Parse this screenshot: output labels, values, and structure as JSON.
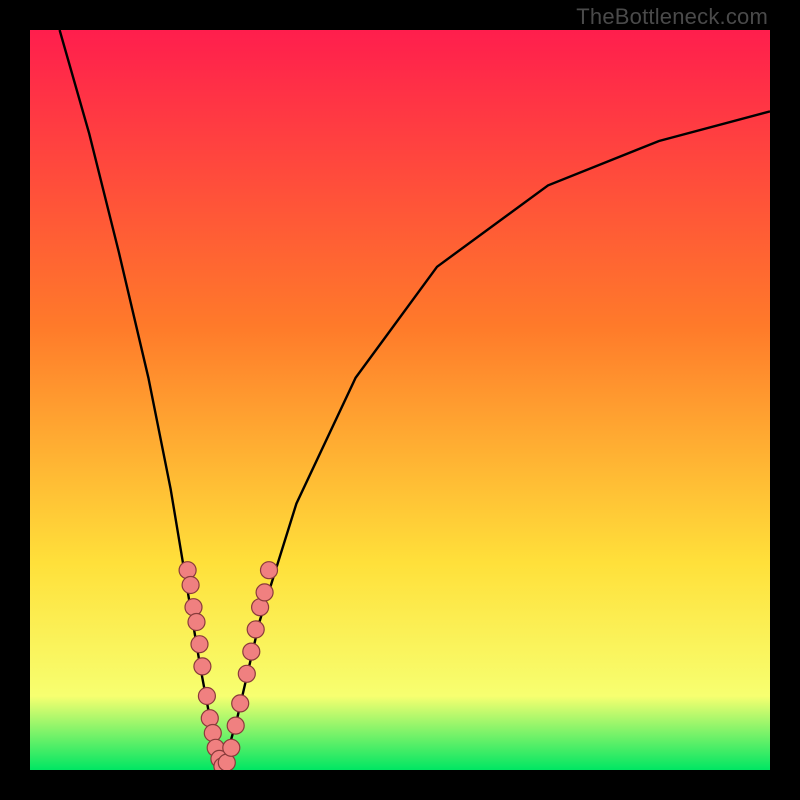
{
  "watermark": "TheBottleneck.com",
  "colors": {
    "bg": "#000000",
    "gradient_top": "#ff1e4d",
    "gradient_mid1": "#ff7a2a",
    "gradient_mid2": "#ffe03a",
    "gradient_mid3": "#f7ff70",
    "gradient_bottom": "#00e663",
    "curve": "#000000",
    "dot_fill": "#f08080",
    "dot_stroke": "#8a3b3b"
  },
  "chart_data": {
    "type": "line",
    "title": "",
    "xlabel": "",
    "ylabel": "",
    "xlim": [
      0,
      100
    ],
    "ylim": [
      0,
      100
    ],
    "curve": {
      "left_branch": [
        {
          "x": 4,
          "y": 100
        },
        {
          "x": 8,
          "y": 86
        },
        {
          "x": 12,
          "y": 70
        },
        {
          "x": 16,
          "y": 53
        },
        {
          "x": 19,
          "y": 38
        },
        {
          "x": 21,
          "y": 26
        },
        {
          "x": 23,
          "y": 14
        },
        {
          "x": 24.5,
          "y": 6
        },
        {
          "x": 26,
          "y": 0
        }
      ],
      "right_branch": [
        {
          "x": 26,
          "y": 0
        },
        {
          "x": 28,
          "y": 7
        },
        {
          "x": 31,
          "y": 20
        },
        {
          "x": 36,
          "y": 36
        },
        {
          "x": 44,
          "y": 53
        },
        {
          "x": 55,
          "y": 68
        },
        {
          "x": 70,
          "y": 79
        },
        {
          "x": 85,
          "y": 85
        },
        {
          "x": 100,
          "y": 89
        }
      ]
    },
    "highlight_points": [
      {
        "x": 21.3,
        "y": 27
      },
      {
        "x": 21.7,
        "y": 25
      },
      {
        "x": 22.1,
        "y": 22
      },
      {
        "x": 22.5,
        "y": 20
      },
      {
        "x": 22.9,
        "y": 17
      },
      {
        "x": 23.3,
        "y": 14
      },
      {
        "x": 23.9,
        "y": 10
      },
      {
        "x": 24.3,
        "y": 7
      },
      {
        "x": 24.7,
        "y": 5
      },
      {
        "x": 25.1,
        "y": 3
      },
      {
        "x": 25.6,
        "y": 1.5
      },
      {
        "x": 26.0,
        "y": 0.5
      },
      {
        "x": 26.6,
        "y": 1
      },
      {
        "x": 27.2,
        "y": 3
      },
      {
        "x": 27.8,
        "y": 6
      },
      {
        "x": 28.4,
        "y": 9
      },
      {
        "x": 29.3,
        "y": 13
      },
      {
        "x": 29.9,
        "y": 16
      },
      {
        "x": 30.5,
        "y": 19
      },
      {
        "x": 31.1,
        "y": 22
      },
      {
        "x": 31.7,
        "y": 24
      },
      {
        "x": 32.3,
        "y": 27
      }
    ]
  }
}
